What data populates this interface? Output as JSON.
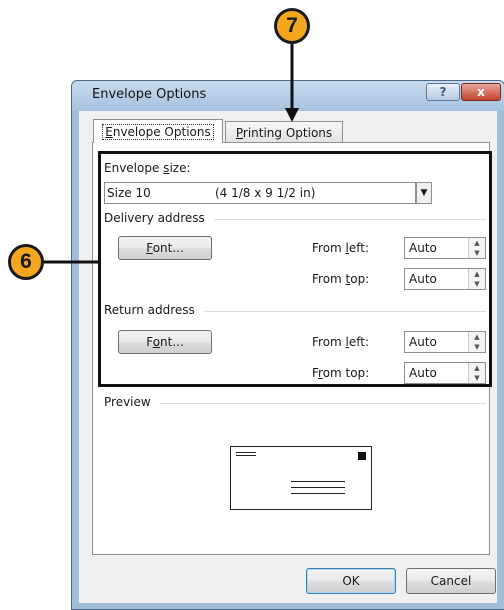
{
  "callouts": {
    "tab_marker": "7",
    "box_marker": "6"
  },
  "window": {
    "title": "Envelope Options"
  },
  "tabs": [
    {
      "label": "Envelope Options",
      "hotkey": "E",
      "rest": "nvelope Options"
    },
    {
      "label": "Printing Options",
      "hotkey": "P",
      "rest": "rinting Options"
    }
  ],
  "envelope_size": {
    "label_pre": "Envelope ",
    "label_key": "s",
    "label_post": "ize:",
    "name": "Size 10",
    "dimensions": "(4 1/8 x 9 1/2 in)"
  },
  "delivery": {
    "title": "Delivery address",
    "font_btn_key": "F",
    "font_btn_rest": "ont...",
    "from_left_pre": "From ",
    "from_left_key": "l",
    "from_left_post": "eft:",
    "from_left_value": "Auto",
    "from_top_pre": "From ",
    "from_top_key": "t",
    "from_top_post": "op:",
    "from_top_value": "Auto"
  },
  "return": {
    "title": "Return address",
    "font_btn_pre": "F",
    "font_btn_key": "o",
    "font_btn_rest": "nt...",
    "from_left_pre": "From ",
    "from_left_key": "l",
    "from_left_post": "eft:",
    "from_left_value": "Auto",
    "from_top_pre": "F",
    "from_top_key": "r",
    "from_top_post": "om top:",
    "from_top_value": "Auto"
  },
  "preview": {
    "title": "Preview"
  },
  "buttons": {
    "ok": "OK",
    "cancel": "Cancel"
  },
  "titlebar": {
    "help": "?",
    "close": "x"
  },
  "colors": {
    "callout_fill": "#f2a71e",
    "close_red": "#c2452e"
  },
  "icons": [
    "question-icon",
    "close-icon",
    "dropdown-arrow-icon",
    "spin-up-icon",
    "spin-down-icon"
  ]
}
